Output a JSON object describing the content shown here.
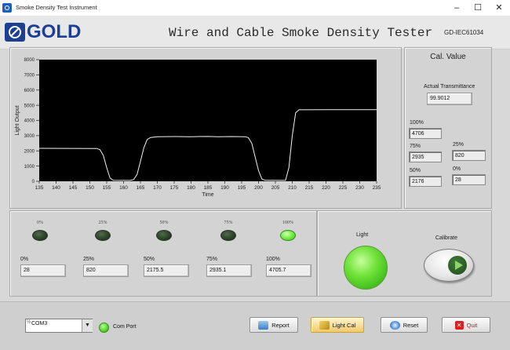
{
  "window": {
    "title": "Smoke Density Test Instrument",
    "controls": [
      "–",
      "☐",
      "✕"
    ]
  },
  "header": {
    "logo_text": "GOLD",
    "title": "Wire and Cable Smoke Density Tester",
    "model": "GD-IEC61034"
  },
  "chart_data": {
    "type": "line",
    "xlabel": "Time",
    "ylabel": "Light Output",
    "xlim": [
      135,
      235
    ],
    "ylim": [
      0,
      8000
    ],
    "x_ticks": [
      135,
      140,
      145,
      150,
      155,
      160,
      165,
      170,
      175,
      180,
      185,
      190,
      195,
      200,
      205,
      210,
      215,
      220,
      225,
      230,
      235
    ],
    "y_ticks": [
      0,
      1000,
      2000,
      3000,
      4000,
      5000,
      6000,
      7000,
      8000
    ],
    "background": "#000000",
    "line_color": "#f2f2f2",
    "series": [
      {
        "points": [
          [
            135,
            2170
          ],
          [
            152,
            2160
          ],
          [
            153,
            2080
          ],
          [
            154,
            1700
          ],
          [
            155,
            900
          ],
          [
            156,
            200
          ],
          [
            157,
            60
          ],
          [
            162,
            55
          ],
          [
            163,
            120
          ],
          [
            164,
            450
          ],
          [
            165,
            1300
          ],
          [
            166,
            2200
          ],
          [
            167,
            2750
          ],
          [
            168,
            2880
          ],
          [
            170,
            2930
          ],
          [
            175,
            2940
          ],
          [
            180,
            2930
          ],
          [
            185,
            2945
          ],
          [
            188,
            2930
          ],
          [
            192,
            2940
          ],
          [
            196,
            2930
          ],
          [
            197,
            2870
          ],
          [
            198,
            2500
          ],
          [
            199,
            1600
          ],
          [
            200,
            700
          ],
          [
            201,
            150
          ],
          [
            202,
            60
          ],
          [
            208,
            55
          ],
          [
            209,
            900
          ],
          [
            210,
            3000
          ],
          [
            211,
            4500
          ],
          [
            212,
            4700
          ],
          [
            220,
            4705
          ],
          [
            230,
            4706
          ],
          [
            235,
            4706
          ]
        ]
      }
    ]
  },
  "calibration": {
    "title": "Cal. Value",
    "actual_label": "Actual Transmittance",
    "actual_value": "99.9012",
    "fields": [
      {
        "label": "100%",
        "value": "4706"
      },
      {
        "label": "75%",
        "value": "2935"
      },
      {
        "label": "25%",
        "value": "820"
      },
      {
        "label": "50%",
        "value": "2176"
      },
      {
        "label": "0%",
        "value": "28"
      }
    ]
  },
  "indicators": {
    "leds": [
      {
        "label": "0%",
        "on": false
      },
      {
        "label": "25%",
        "on": false
      },
      {
        "label": "50%",
        "on": false
      },
      {
        "label": "75%",
        "on": false
      },
      {
        "label": "100%",
        "on": true
      }
    ],
    "readings": [
      {
        "label": "0%",
        "value": "28"
      },
      {
        "label": "25%",
        "value": "820"
      },
      {
        "label": "50%",
        "value": "2175.5"
      },
      {
        "label": "75%",
        "value": "2935.1"
      },
      {
        "label": "100%",
        "value": "4705.7"
      }
    ]
  },
  "controls": {
    "light_label": "Light",
    "calibrate_label": "Calibrate"
  },
  "bottom": {
    "com_prefix": "½",
    "com_value": "COM3",
    "com_label": "Com Port",
    "buttons": {
      "report": "Report",
      "light_cal": "Light Cal",
      "reset": "Reset",
      "quit": "Quit"
    }
  }
}
